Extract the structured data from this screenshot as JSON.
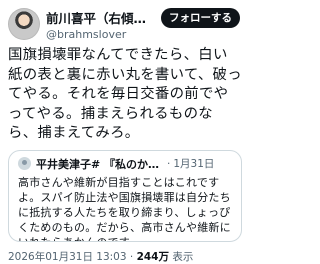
{
  "author": {
    "display_name": "前川喜平（右傾化を…",
    "handle": "@brahmslover"
  },
  "follow_label": "フォローする",
  "body": "国旗損壊罪なんてできたら、白い紙の表と裏に赤い丸を書いて、破ってやる。それを毎日交番の前でやってやる。捕まえられるものなら、捕まえてみろ。",
  "quote": {
    "display_name": "平井美津子# 『私のからだは私…",
    "separator": "·",
    "date": "1月31日",
    "text": "高市さんや維新が目指すことはこれですよ。スパイ防止法や国旗損壊罪は自分たちに抵抗する人たちを取り締まり、しょっぴくためのもの。だから、高市さんや維新にいれたらあかんのです。"
  },
  "meta": {
    "timestamp": "2026年01月31日 13:03 ·",
    "views_count": "244万",
    "views_label": "表示"
  }
}
